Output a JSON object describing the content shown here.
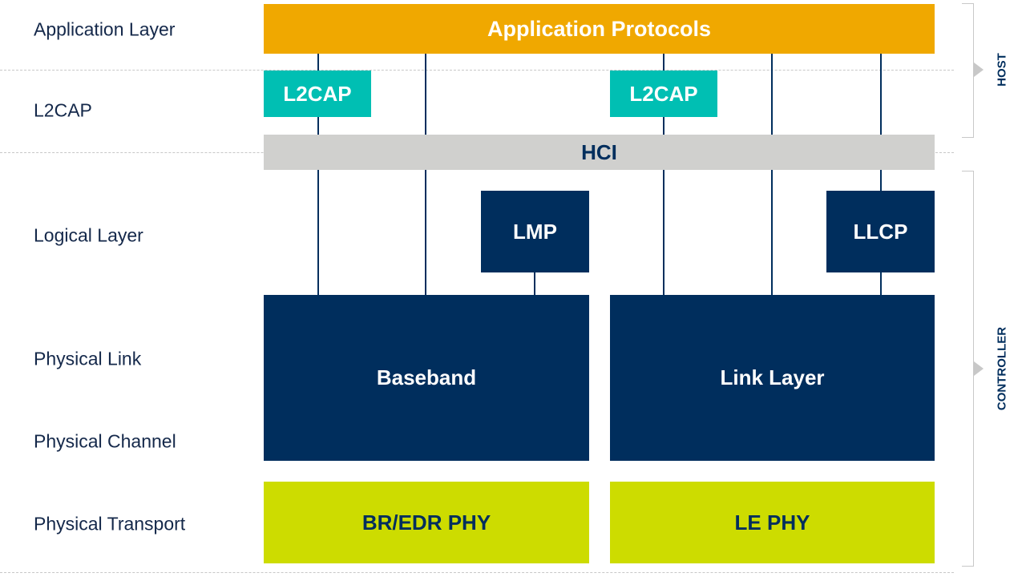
{
  "layers": [
    "Application Layer",
    "L2CAP",
    "Logical Layer",
    "Physical Link",
    "Physical Channel",
    "Physical Transport"
  ],
  "blocks": {
    "app_protocols": "Application Protocols",
    "l2cap_left": "L2CAP",
    "l2cap_right": "L2CAP",
    "hci": "HCI",
    "lmp": "LMP",
    "llcp": "LLCP",
    "baseband": "Baseband",
    "link_layer": "Link Layer",
    "bredr_phy": "BR/EDR PHY",
    "le_phy": "LE PHY"
  },
  "groups": {
    "host": "HOST",
    "controller": "CONTROLLER"
  },
  "colors": {
    "navy": "#002e5d",
    "orange": "#f0a800",
    "teal": "#00bfb3",
    "grey": "#d0d0ce",
    "lime": "#cddc00"
  }
}
